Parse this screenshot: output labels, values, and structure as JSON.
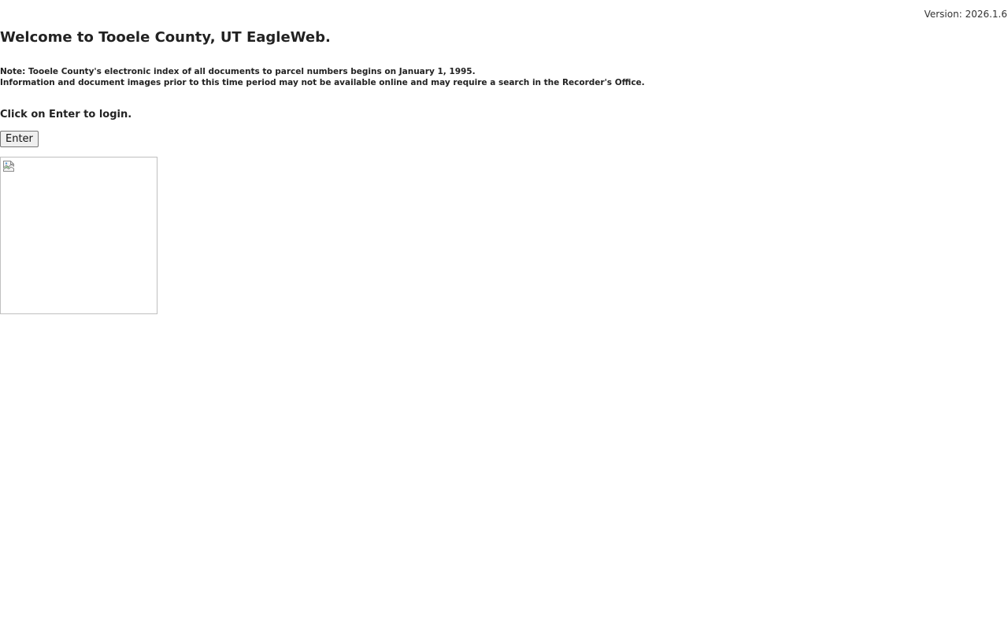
{
  "header": {
    "version": "Version: 2026.1.6"
  },
  "main": {
    "title": "Welcome to Tooele County, UT EagleWeb.",
    "note_line1": "Note: Tooele County's electronic index of all documents to parcel numbers begins on January 1, 1995.",
    "note_line2": "Information and document images prior to this time period may not be available online and may require a search in the Recorder's Office.",
    "login_prompt": "Click on Enter to login.",
    "enter_button_label": "Enter"
  },
  "image": {
    "icon": "broken-image-icon"
  }
}
